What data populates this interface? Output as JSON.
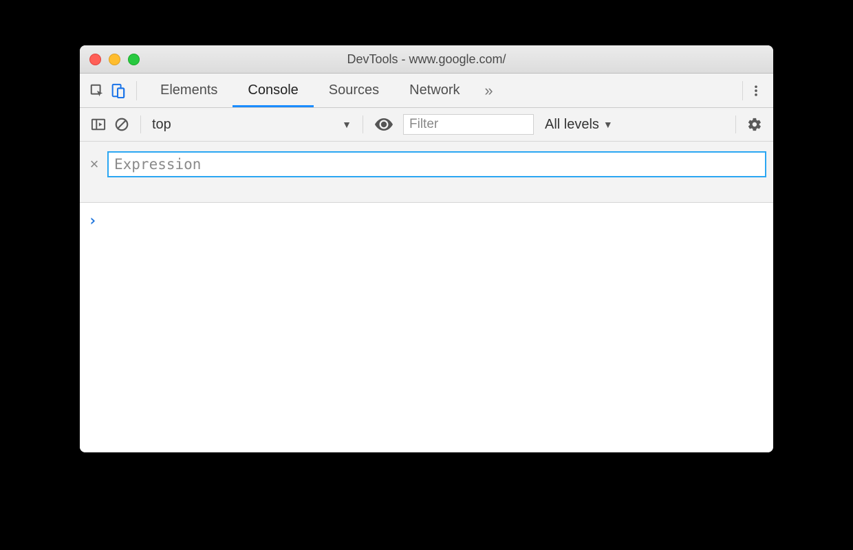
{
  "window": {
    "title": "DevTools - www.google.com/"
  },
  "tabs": {
    "items": [
      "Elements",
      "Console",
      "Sources",
      "Network"
    ],
    "active_index": 1,
    "more_glyph": "»"
  },
  "console_toolbar": {
    "context": "top",
    "filter_placeholder": "Filter",
    "levels_label": "All levels",
    "caret": "▼"
  },
  "live_expression": {
    "placeholder": "Expression",
    "close_glyph": "×"
  },
  "console": {
    "prompt": "›"
  }
}
